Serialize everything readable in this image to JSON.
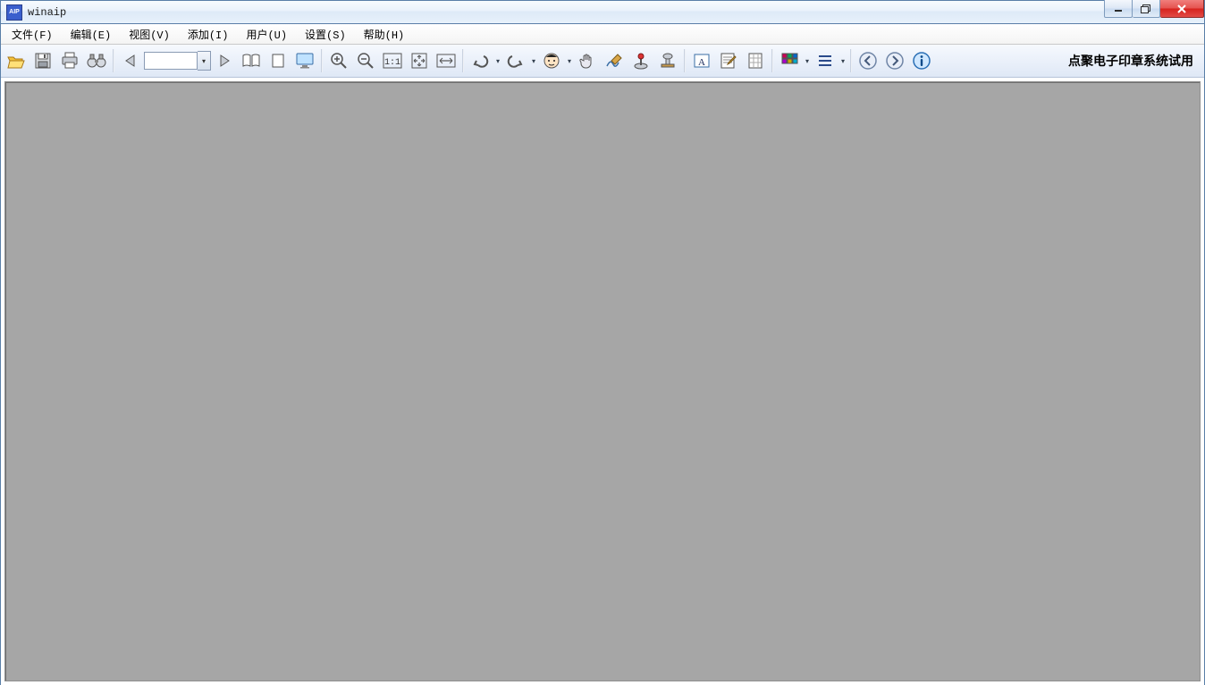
{
  "title": "winaip",
  "app_icon_text": "AIP",
  "menubar": {
    "file": "文件(F)",
    "edit": "编辑(E)",
    "view": "视图(V)",
    "add": "添加(I)",
    "user": "用户(U)",
    "settings": "设置(S)",
    "help": "帮助(H)"
  },
  "toolbar": {
    "page_value": "",
    "trial_label": "点聚电子印章系统试用",
    "icons": {
      "open": "open",
      "save": "save",
      "print": "print",
      "find": "find",
      "prev": "prev",
      "next": "next",
      "facing": "facing",
      "single": "single",
      "fullscreen": "fullscreen",
      "zoomin": "zoomin",
      "zoomout": "zoomout",
      "actual": "actual",
      "fitpage": "fitpage",
      "fitwidth": "fitwidth",
      "undo": "undo",
      "redo": "redo",
      "face": "face",
      "hand": "hand",
      "sign": "sign",
      "joystick": "joystick",
      "stamp": "stamp",
      "textbox": "textbox",
      "note": "note",
      "grid-doc": "grid-doc",
      "thumbs": "thumbs",
      "outline": "outline",
      "navprev": "navprev",
      "navnext": "navnext",
      "info": "info"
    }
  }
}
